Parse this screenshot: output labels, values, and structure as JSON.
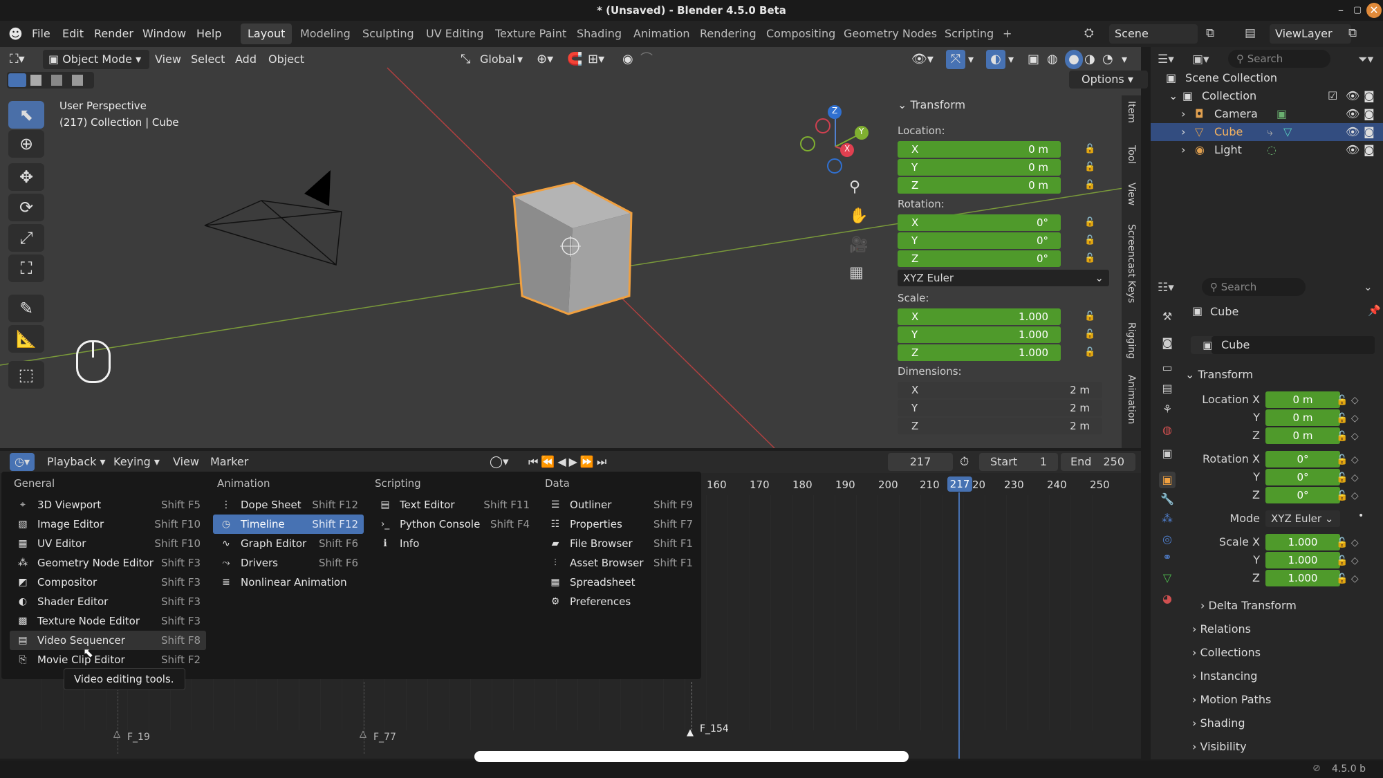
{
  "window": {
    "title": "* (Unsaved) - Blender 4.5.0 Beta",
    "minimize": "–",
    "maximize": "▢",
    "close": "✕"
  },
  "menubar": {
    "menus": [
      "File",
      "Edit",
      "Render",
      "Window",
      "Help"
    ],
    "workspaces": [
      "Layout",
      "Modeling",
      "Sculpting",
      "UV Editing",
      "Texture Paint",
      "Shading",
      "Animation",
      "Rendering",
      "Compositing",
      "Geometry Nodes",
      "Scripting",
      "+"
    ],
    "active_workspace": "Layout",
    "scene": "Scene",
    "view_layer": "ViewLayer"
  },
  "viewport": {
    "mode": "Object Mode",
    "menus": [
      "View",
      "Select",
      "Add",
      "Object"
    ],
    "orientation": "Global",
    "options": "Options",
    "overlay_title": "User Perspective",
    "overlay_sub": "(217) Collection | Cube",
    "gizmo_axes": {
      "x": "X",
      "y": "Y",
      "z": "Z"
    },
    "side_tabs": [
      "Item",
      "Tool",
      "View",
      "Screencast Keys",
      "Rigging",
      "Animation"
    ]
  },
  "transform_panel": {
    "title": "Transform",
    "location_label": "Location:",
    "location": [
      {
        "axis": "X",
        "value": "0 m"
      },
      {
        "axis": "Y",
        "value": "0 m"
      },
      {
        "axis": "Z",
        "value": "0 m"
      }
    ],
    "rotation_label": "Rotation:",
    "rotation": [
      {
        "axis": "X",
        "value": "0°"
      },
      {
        "axis": "Y",
        "value": "0°"
      },
      {
        "axis": "Z",
        "value": "0°"
      }
    ],
    "rotation_mode": "XYZ Euler",
    "scale_label": "Scale:",
    "scale": [
      {
        "axis": "X",
        "value": "1.000"
      },
      {
        "axis": "Y",
        "value": "1.000"
      },
      {
        "axis": "Z",
        "value": "1.000"
      }
    ],
    "dimensions_label": "Dimensions:",
    "dimensions": [
      {
        "axis": "X",
        "value": "2 m"
      },
      {
        "axis": "Y",
        "value": "2 m"
      },
      {
        "axis": "Z",
        "value": "2 m"
      }
    ]
  },
  "timeline": {
    "menus": [
      "Playback",
      "Keying",
      "View",
      "Marker"
    ],
    "current_frame": "217",
    "start_label": "Start",
    "start": "1",
    "end_label": "End",
    "end": "250",
    "ticks": [
      "160",
      "170",
      "180",
      "190",
      "200",
      "210",
      "217",
      "20",
      "230",
      "240",
      "250"
    ],
    "markers": [
      "F_19",
      "F_77",
      "F_154"
    ]
  },
  "editor_menu": {
    "columns": [
      {
        "heading": "General",
        "items": [
          {
            "label": "3D Viewport",
            "shortcut": "Shift F5",
            "icon": "viewport-icon"
          },
          {
            "label": "Image Editor",
            "shortcut": "Shift F10",
            "icon": "image-icon"
          },
          {
            "label": "UV Editor",
            "shortcut": "Shift F10",
            "icon": "uv-icon"
          },
          {
            "label": "Geometry Node Editor",
            "shortcut": "Shift F3",
            "icon": "nodes-icon"
          },
          {
            "label": "Compositor",
            "shortcut": "Shift F3",
            "icon": "compositor-icon"
          },
          {
            "label": "Shader Editor",
            "shortcut": "Shift F3",
            "icon": "shader-icon"
          },
          {
            "label": "Texture Node Editor",
            "shortcut": "Shift F3",
            "icon": "texture-icon"
          },
          {
            "label": "Video Sequencer",
            "shortcut": "Shift F8",
            "icon": "sequencer-icon"
          },
          {
            "label": "Movie Clip Editor",
            "shortcut": "Shift F2",
            "icon": "clip-icon"
          }
        ]
      },
      {
        "heading": "Animation",
        "items": [
          {
            "label": "Dope Sheet",
            "shortcut": "Shift F12",
            "icon": "dopesheet-icon"
          },
          {
            "label": "Timeline",
            "shortcut": "Shift F12",
            "icon": "timeline-icon"
          },
          {
            "label": "Graph Editor",
            "shortcut": "Shift F6",
            "icon": "graph-icon"
          },
          {
            "label": "Drivers",
            "shortcut": "Shift F6",
            "icon": "drivers-icon"
          },
          {
            "label": "Nonlinear Animation",
            "shortcut": "",
            "icon": "nla-icon"
          }
        ]
      },
      {
        "heading": "Scripting",
        "items": [
          {
            "label": "Text Editor",
            "shortcut": "Shift F11",
            "icon": "text-icon"
          },
          {
            "label": "Python Console",
            "shortcut": "Shift F4",
            "icon": "console-icon"
          },
          {
            "label": "Info",
            "shortcut": "",
            "icon": "info-icon"
          }
        ]
      },
      {
        "heading": "Data",
        "items": [
          {
            "label": "Outliner",
            "shortcut": "Shift F9",
            "icon": "outliner-icon"
          },
          {
            "label": "Properties",
            "shortcut": "Shift F7",
            "icon": "properties-icon"
          },
          {
            "label": "File Browser",
            "shortcut": "Shift F1",
            "icon": "folder-icon"
          },
          {
            "label": "Asset Browser",
            "shortcut": "Shift F1",
            "icon": "asset-icon"
          },
          {
            "label": "Spreadsheet",
            "shortcut": "",
            "icon": "spreadsheet-icon"
          },
          {
            "label": "Preferences",
            "shortcut": "",
            "icon": "gear-icon"
          }
        ]
      }
    ],
    "tooltip": "Video editing tools."
  },
  "outliner": {
    "search_placeholder": "Search",
    "scene_collection": "Scene Collection",
    "collection": "Collection",
    "items": [
      "Camera",
      "Cube",
      "Light"
    ]
  },
  "properties": {
    "search_placeholder": "Search",
    "object_name": "Cube",
    "object_data_name": "Cube",
    "transform_title": "Transform",
    "location_x_label": "Location X",
    "y_label": "Y",
    "z_label": "Z",
    "location": [
      "0 m",
      "0 m",
      "0 m"
    ],
    "rotation_x_label": "Rotation X",
    "rotation": [
      "0°",
      "0°",
      "0°"
    ],
    "mode_label": "Mode",
    "mode": "XYZ Euler",
    "scale_x_label": "Scale X",
    "scale": [
      "1.000",
      "1.000",
      "1.000"
    ],
    "sections": [
      "Delta Transform",
      "Relations",
      "Collections",
      "Instancing",
      "Motion Paths",
      "Shading",
      "Visibility"
    ]
  },
  "statusbar": {
    "version": "4.5.0 b"
  },
  "colors": {
    "accent": "#4772b3",
    "field_green": "#4f9a2b",
    "selection_orange": "#f0a040"
  }
}
